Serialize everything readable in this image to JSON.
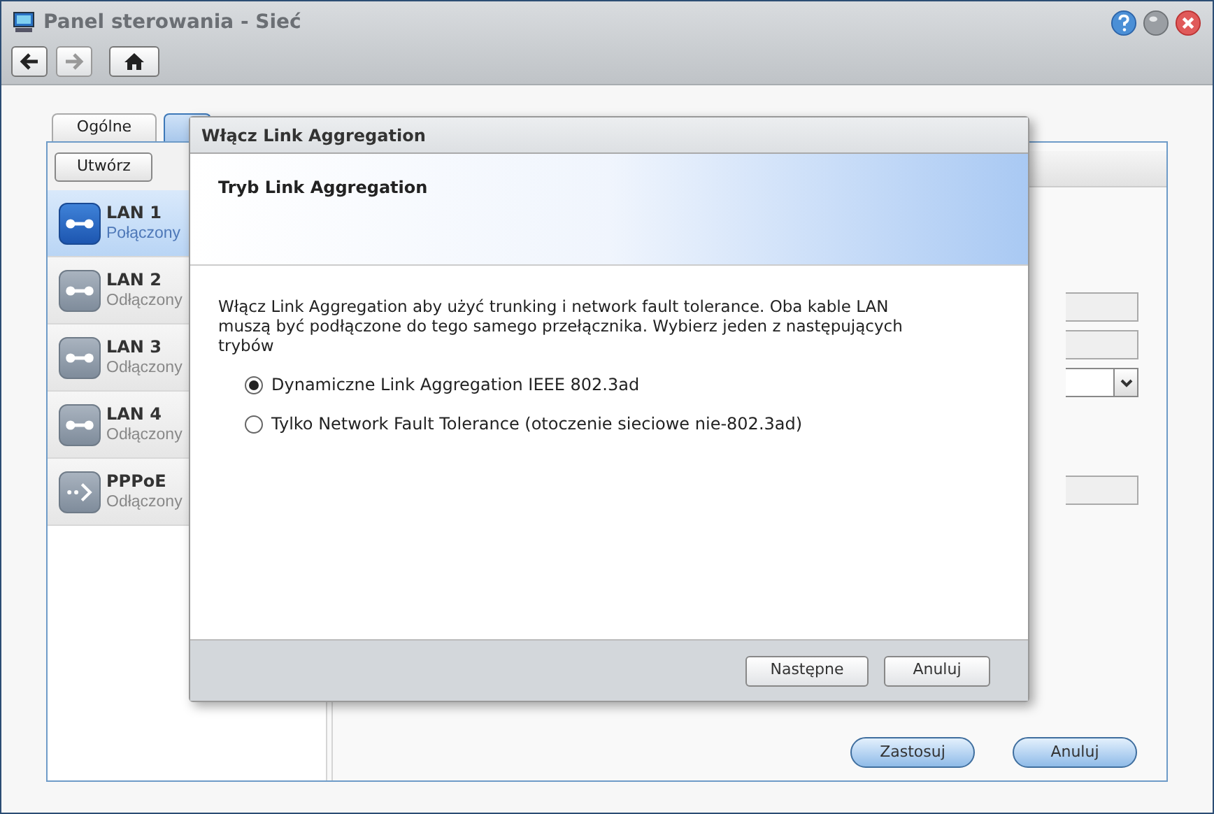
{
  "window": {
    "title": "Panel sterowania - Sieć"
  },
  "tabs": [
    {
      "label": "Ogólne",
      "selected": false
    },
    {
      "selected": true
    }
  ],
  "create_button": "Utwórz",
  "interfaces": [
    {
      "name": "LAN 1",
      "status": "Połączony",
      "selected": true,
      "kind": "lan"
    },
    {
      "name": "LAN 2",
      "status": "Odłączony",
      "selected": false,
      "kind": "lan"
    },
    {
      "name": "LAN 3",
      "status": "Odłączony",
      "selected": false,
      "kind": "lan"
    },
    {
      "name": "LAN 4",
      "status": "Odłączony",
      "selected": false,
      "kind": "lan"
    },
    {
      "name": "PPPoE",
      "status": "Odłączony",
      "selected": false,
      "kind": "pppoe"
    }
  ],
  "dialog": {
    "title": "Włącz Link Aggregation",
    "heading": "Tryb Link Aggregation",
    "description": "Włącz Link Aggregation aby użyć trunking i network fault tolerance. Oba kable LAN muszą być podłączone do tego samego przełącznika. Wybierz jeden z następujących trybów",
    "options": [
      {
        "label": "Dynamiczne Link Aggregation IEEE 802.3ad",
        "selected": true
      },
      {
        "label": "Tylko Network Fault Tolerance (otoczenie sieciowe nie-802.3ad)",
        "selected": false
      }
    ],
    "buttons": [
      "Następne",
      "Anuluj"
    ]
  },
  "footer_buttons": [
    "Zastosuj",
    "Anuluj"
  ]
}
